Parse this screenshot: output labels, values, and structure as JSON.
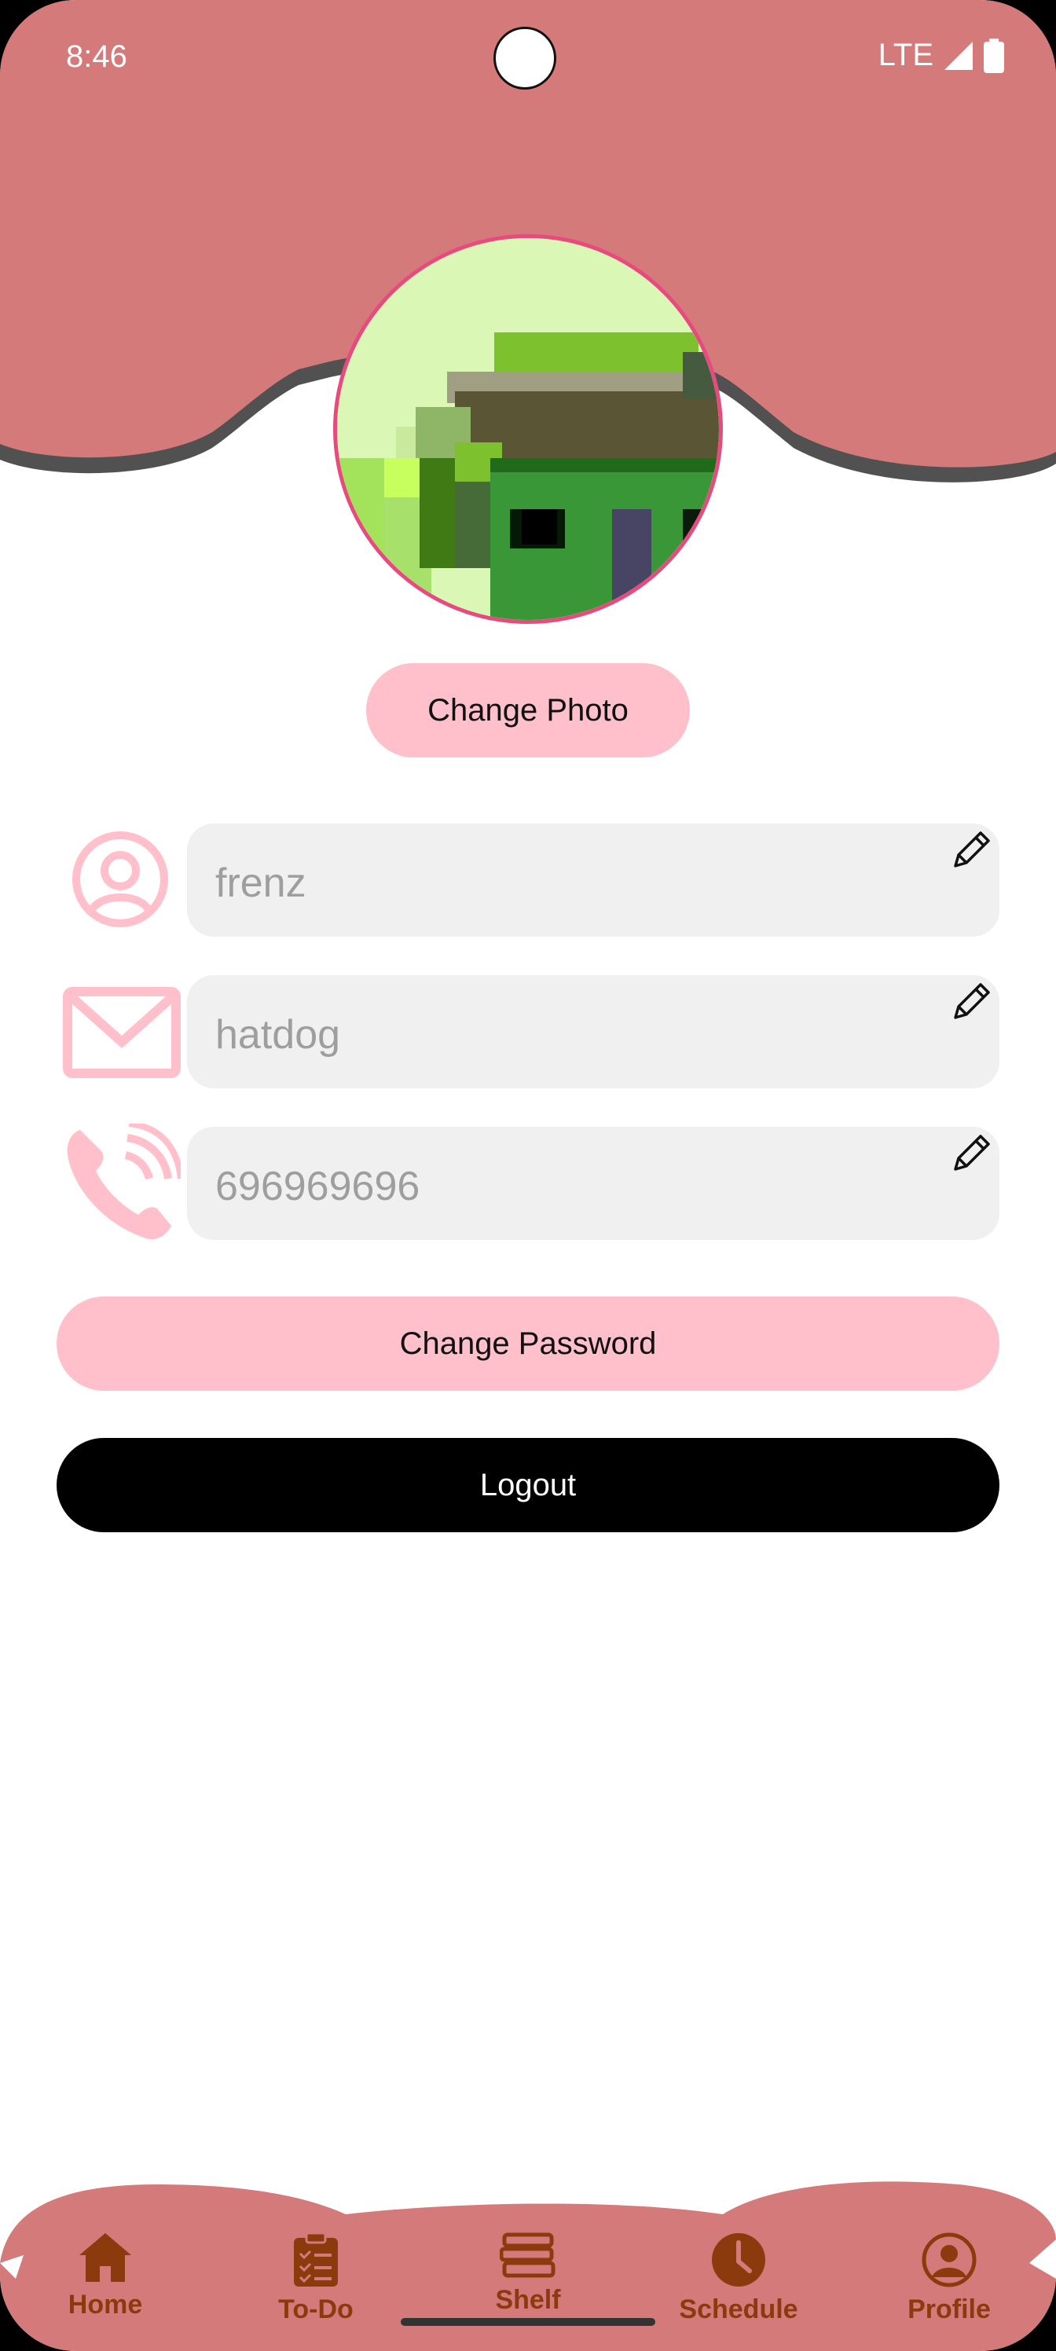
{
  "status_bar": {
    "time": "8:46",
    "network": "LTE"
  },
  "colors": {
    "header": "#d57a7a",
    "accent_pink": "#ffbfcb",
    "nav_text": "#8b3a0e",
    "avatar_border": "#e84a7f"
  },
  "profile": {
    "change_photo_label": "Change Photo",
    "fields": [
      {
        "icon": "user-icon",
        "value": "frenz"
      },
      {
        "icon": "mail-icon",
        "value": "hatdog"
      },
      {
        "icon": "phone-icon",
        "value": "696969696"
      }
    ],
    "change_password_label": "Change Password",
    "logout_label": "Logout"
  },
  "nav": {
    "items": [
      {
        "label": "Home",
        "icon": "home-icon"
      },
      {
        "label": "To-Do",
        "icon": "clipboard-icon"
      },
      {
        "label": "Shelf",
        "icon": "books-icon"
      },
      {
        "label": "Schedule",
        "icon": "clock-icon"
      },
      {
        "label": "Profile",
        "icon": "profile-icon"
      }
    ]
  }
}
